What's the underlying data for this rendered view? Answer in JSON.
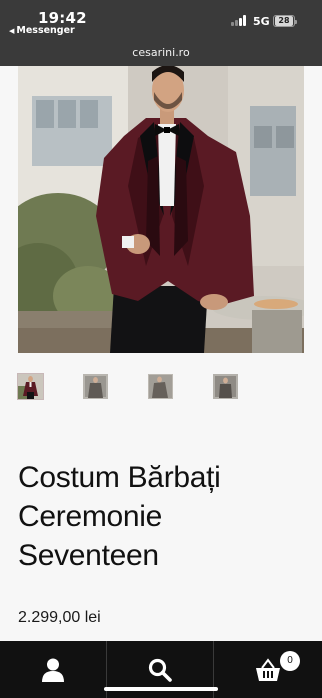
{
  "status_bar": {
    "time": "19:42",
    "back_app": "Messenger",
    "network": "5G",
    "battery": "28"
  },
  "browser": {
    "url": "cesarini.ro"
  },
  "product": {
    "image_icon": "product-photo",
    "thumbnails": [
      "thumb-1",
      "thumb-2",
      "thumb-3",
      "thumb-4"
    ],
    "title_lines": [
      "Costum Bărbați",
      "Ceremonie",
      "Seventeen"
    ],
    "price": "2.299,00 lei"
  },
  "bottom_nav": {
    "account_icon": "user-icon",
    "search_icon": "search-icon",
    "cart_icon": "basket-icon",
    "cart_count": "0"
  },
  "colors": {
    "suit": "#5a1a24",
    "top_bar": "#3a3a3a",
    "bottom_bar": "#111111"
  }
}
